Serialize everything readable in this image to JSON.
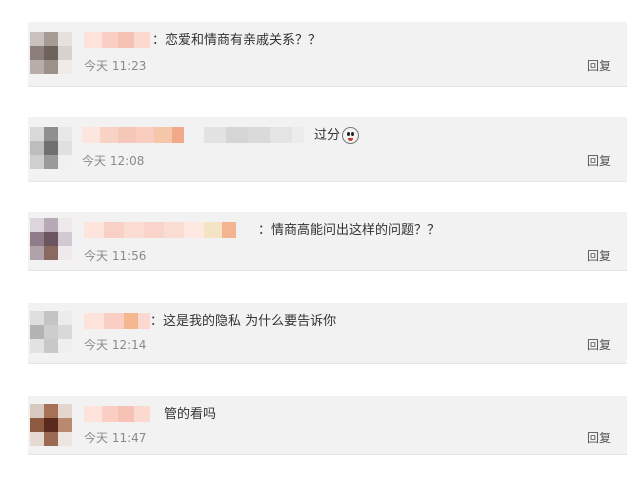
{
  "comments": [
    {
      "text": "：恋爱和情商有亲戚关系？？",
      "time": "今天 11:23",
      "reply_label": "回复"
    },
    {
      "text": "过分",
      "time": "今天 12:08",
      "reply_label": "回复",
      "emoji": "shocked-face-icon"
    },
    {
      "text": "：情商高能问出这样的问题？？",
      "time": "今天 11:56",
      "reply_label": "回复"
    },
    {
      "text": "：这是我的隐私 为什么要告诉你",
      "time": "今天 12:14",
      "reply_label": "回复"
    },
    {
      "text": "管的看吗",
      "time": "今天 11:47",
      "reply_label": "回复"
    }
  ],
  "colors": {
    "card_background": "#f2f2f2",
    "text": "#333333",
    "timestamp": "#8a8a8a"
  }
}
